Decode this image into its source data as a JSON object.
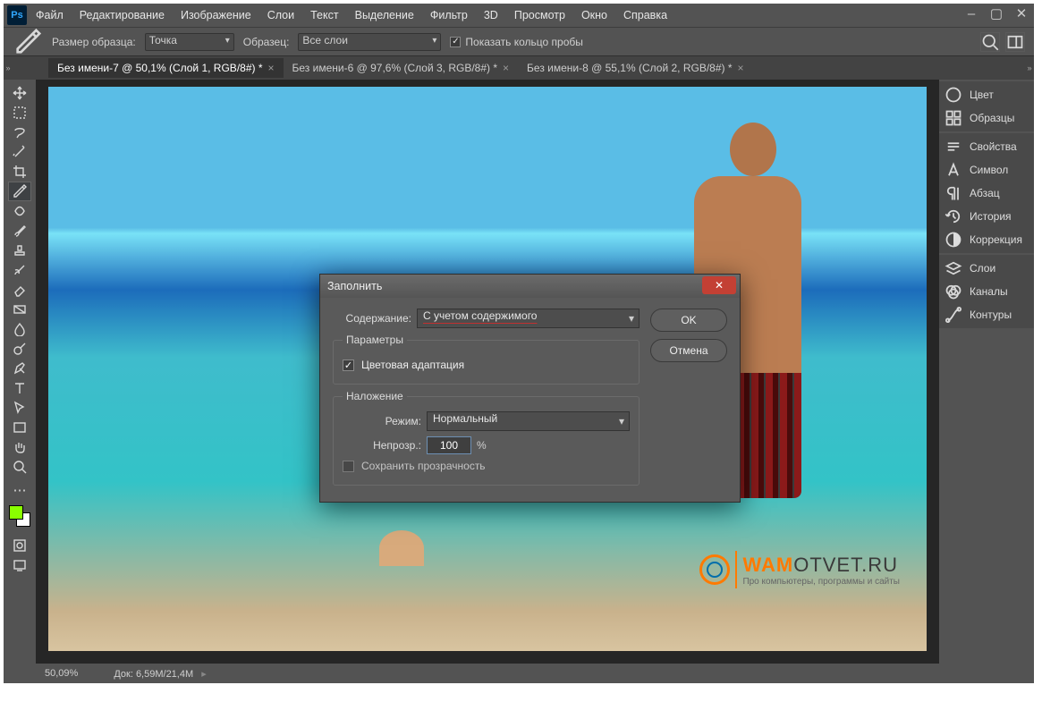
{
  "menu": {
    "items": [
      "Файл",
      "Редактирование",
      "Изображение",
      "Слои",
      "Текст",
      "Выделение",
      "Фильтр",
      "3D",
      "Просмотр",
      "Окно",
      "Справка"
    ]
  },
  "options": {
    "sample_size_label": "Размер образца:",
    "sample_size_value": "Точка",
    "sample_label": "Образец:",
    "sample_value": "Все слои",
    "show_ring_label": "Показать кольцо пробы"
  },
  "tabs": [
    {
      "label": "Без имени-7 @ 50,1% (Слой 1, RGB/8#) *",
      "active": true
    },
    {
      "label": "Без имени-6 @ 97,6% (Слой 3, RGB/8#) *",
      "active": false
    },
    {
      "label": "Без имени-8 @ 55,1% (Слой 2, RGB/8#) *",
      "active": false
    }
  ],
  "panels": {
    "group1": [
      "Цвет",
      "Образцы"
    ],
    "group2": [
      "Свойства",
      "Символ",
      "Абзац",
      "История",
      "Коррекция"
    ],
    "group3": [
      "Слои",
      "Каналы",
      "Контуры"
    ]
  },
  "status": {
    "zoom": "50,09%",
    "doc_label": "Док:",
    "doc_value": "6,59M/21,4M"
  },
  "dialog": {
    "title": "Заполнить",
    "content_label": "Содержание:",
    "content_value": "С учетом содержимого",
    "group_options": "Параметры",
    "color_adapt_label": "Цветовая адаптация",
    "group_overlay": "Наложение",
    "mode_label": "Режим:",
    "mode_value": "Нормальный",
    "opacity_label": "Непрозр.:",
    "opacity_value": "100",
    "opacity_unit": "%",
    "keep_trans_label": "Сохранить прозрачность",
    "ok": "OK",
    "cancel": "Отмена"
  },
  "watermark": {
    "main1": "WAM",
    "main2": "OTVET.RU",
    "sub": "Про компьютеры, программы и сайты"
  }
}
